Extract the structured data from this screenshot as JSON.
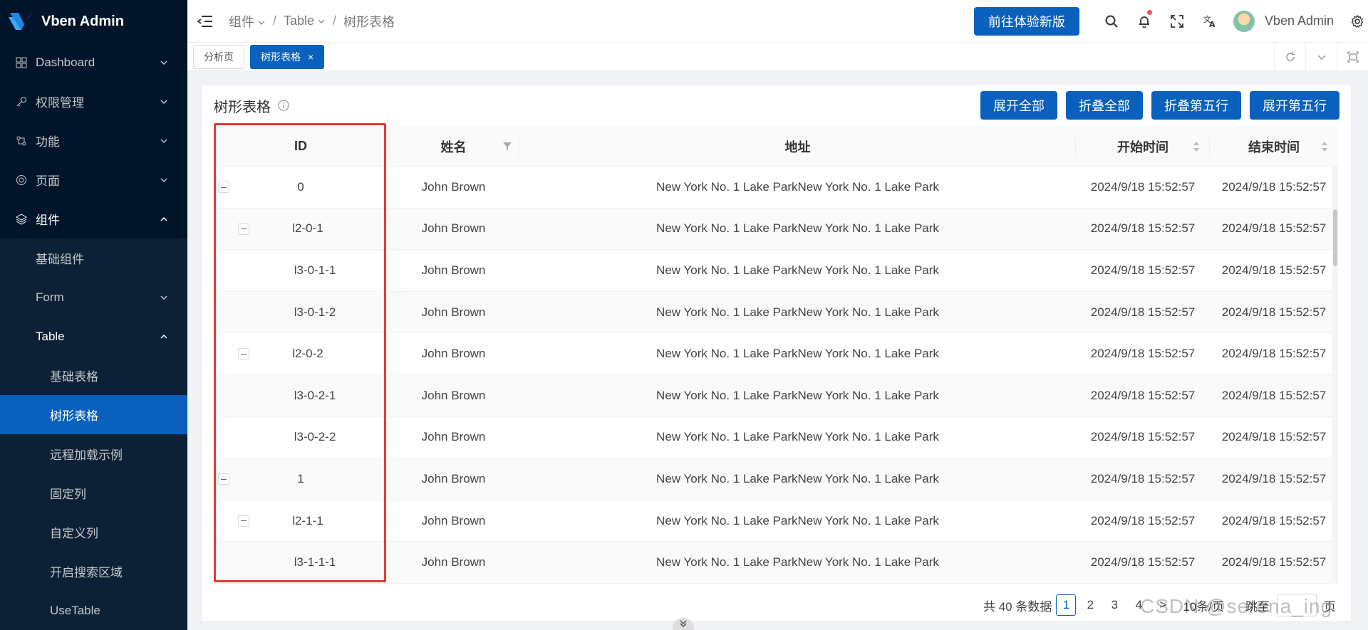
{
  "app": {
    "title": "Vben Admin"
  },
  "sidebar": {
    "items": [
      {
        "label": "Dashboard",
        "icon": "dashboard-icon",
        "expanded": false
      },
      {
        "label": "权限管理",
        "icon": "key-icon",
        "expanded": false
      },
      {
        "label": "功能",
        "icon": "function-icon",
        "expanded": false
      },
      {
        "label": "页面",
        "icon": "page-icon",
        "expanded": false
      },
      {
        "label": "组件",
        "icon": "layers-icon",
        "expanded": true
      }
    ],
    "sub": {
      "basic": "基础组件",
      "form": "Form",
      "table": "Table",
      "table_children": [
        "基础表格",
        "树形表格",
        "远程加载示例",
        "固定列",
        "自定义列",
        "开启搜索区域",
        "UseTable"
      ]
    }
  },
  "header": {
    "breadcrumb": [
      "组件",
      "Table",
      "树形表格"
    ],
    "new_version_button": "前往体验新版",
    "username": "Vben Admin",
    "accent": "#0960bd"
  },
  "tabs": [
    {
      "label": "分析页",
      "active": false
    },
    {
      "label": "树形表格",
      "active": true,
      "close": "×"
    }
  ],
  "card": {
    "title": "树形表格",
    "actions": [
      "展开全部",
      "折叠全部",
      "折叠第五行",
      "展开第五行"
    ]
  },
  "table": {
    "columns": [
      "ID",
      "姓名",
      "地址",
      "开始时间",
      "结束时间"
    ],
    "rows": [
      {
        "id": "0",
        "level": 0,
        "expander": true,
        "name": "John Brown",
        "address": "New York No. 1 Lake ParkNew York No. 1 Lake Park",
        "start": "2024/9/18 15:52:57",
        "end": "2024/9/18 15:52:57"
      },
      {
        "id": "l2-0-1",
        "level": 1,
        "expander": true,
        "name": "John Brown",
        "address": "New York No. 1 Lake ParkNew York No. 1 Lake Park",
        "start": "2024/9/18 15:52:57",
        "end": "2024/9/18 15:52:57"
      },
      {
        "id": "l3-0-1-1",
        "level": 2,
        "expander": false,
        "name": "John Brown",
        "address": "New York No. 1 Lake ParkNew York No. 1 Lake Park",
        "start": "2024/9/18 15:52:57",
        "end": "2024/9/18 15:52:57"
      },
      {
        "id": "l3-0-1-2",
        "level": 2,
        "expander": false,
        "name": "John Brown",
        "address": "New York No. 1 Lake ParkNew York No. 1 Lake Park",
        "start": "2024/9/18 15:52:57",
        "end": "2024/9/18 15:52:57"
      },
      {
        "id": "l2-0-2",
        "level": 1,
        "expander": true,
        "name": "John Brown",
        "address": "New York No. 1 Lake ParkNew York No. 1 Lake Park",
        "start": "2024/9/18 15:52:57",
        "end": "2024/9/18 15:52:57"
      },
      {
        "id": "l3-0-2-1",
        "level": 2,
        "expander": false,
        "name": "John Brown",
        "address": "New York No. 1 Lake ParkNew York No. 1 Lake Park",
        "start": "2024/9/18 15:52:57",
        "end": "2024/9/18 15:52:57"
      },
      {
        "id": "l3-0-2-2",
        "level": 2,
        "expander": false,
        "name": "John Brown",
        "address": "New York No. 1 Lake ParkNew York No. 1 Lake Park",
        "start": "2024/9/18 15:52:57",
        "end": "2024/9/18 15:52:57"
      },
      {
        "id": "1",
        "level": 0,
        "expander": true,
        "name": "John Brown",
        "address": "New York No. 1 Lake ParkNew York No. 1 Lake Park",
        "start": "2024/9/18 15:52:57",
        "end": "2024/9/18 15:52:57"
      },
      {
        "id": "l2-1-1",
        "level": 1,
        "expander": true,
        "name": "John Brown",
        "address": "New York No. 1 Lake ParkNew York No. 1 Lake Park",
        "start": "2024/9/18 15:52:57",
        "end": "2024/9/18 15:52:57"
      },
      {
        "id": "l3-1-1-1",
        "level": 2,
        "expander": false,
        "name": "John Brown",
        "address": "New York No. 1 Lake ParkNew York No. 1 Lake Park",
        "start": "2024/9/18 15:52:57",
        "end": "2024/9/18 15:52:57"
      }
    ]
  },
  "pagination": {
    "total": "共 40 条数据",
    "pages": [
      "1",
      "2",
      "3",
      "4"
    ],
    "current": "1",
    "page_size": "10条/页",
    "jump_label": "跳至",
    "page_unit": "页"
  },
  "watermark": "CSDN @serena_ing"
}
